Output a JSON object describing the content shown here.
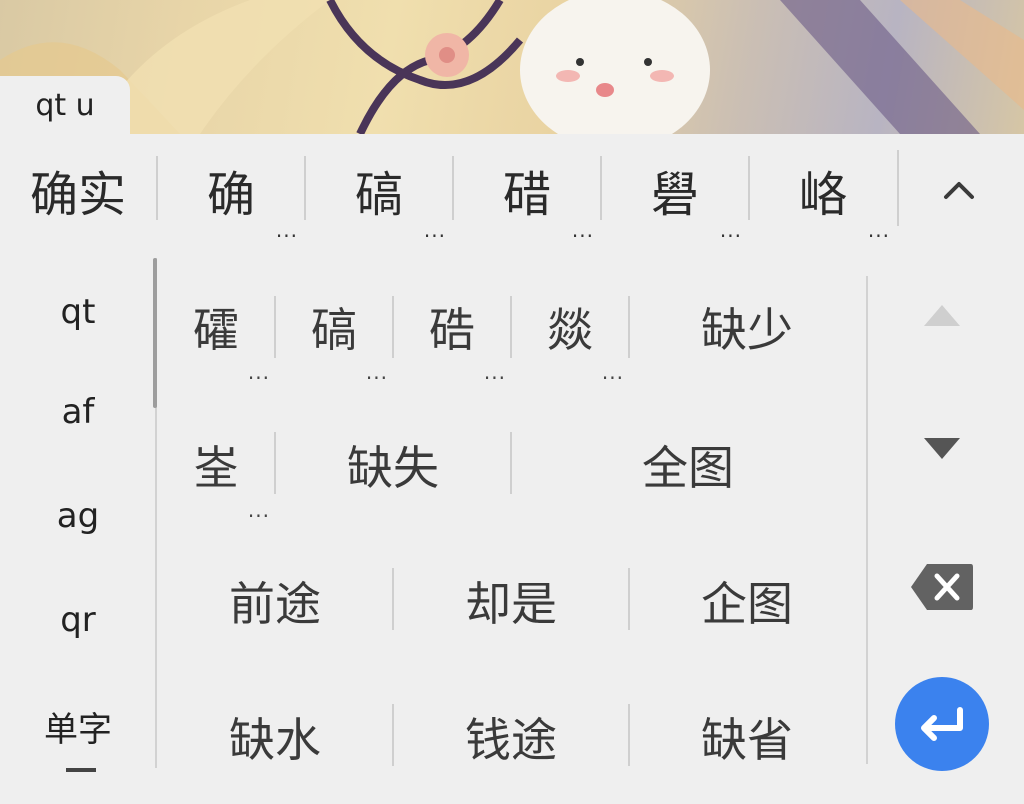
{
  "composing": {
    "text": "qt u"
  },
  "candidates": [
    {
      "text": "确实",
      "has_more": false
    },
    {
      "text": "确",
      "has_more": true,
      "more": "..."
    },
    {
      "text": "碻",
      "has_more": true,
      "more": "..."
    },
    {
      "text": "碏",
      "has_more": true,
      "more": "..."
    },
    {
      "text": "礐",
      "has_more": true,
      "more": "..."
    },
    {
      "text": "峈",
      "has_more": true,
      "more": "..."
    }
  ],
  "expand_icon": "chevron-up-icon",
  "pinyin_options": [
    "qt",
    "af",
    "ag",
    "qr",
    "单字"
  ],
  "grid": {
    "row1": [
      {
        "text": "礭",
        "more": "..."
      },
      {
        "text": "碻",
        "more": "..."
      },
      {
        "text": "硞",
        "more": "..."
      },
      {
        "text": "燚",
        "more": "..."
      },
      {
        "text": "缺少"
      }
    ],
    "row2": [
      {
        "text": "峑",
        "more": "..."
      },
      {
        "text": "缺失"
      },
      {
        "text": "全图"
      }
    ],
    "row3": [
      {
        "text": "前途"
      },
      {
        "text": "却是"
      },
      {
        "text": "企图"
      }
    ],
    "row4": [
      {
        "text": "缺水"
      },
      {
        "text": "钱途"
      },
      {
        "text": "缺省"
      }
    ]
  },
  "side_buttons": {
    "page_up_icon": "triangle-up-icon",
    "page_down_icon": "triangle-down-icon",
    "backspace_icon": "backspace-icon",
    "enter_icon": "enter-icon"
  },
  "colors": {
    "accent": "#3b82ee",
    "background": "#efefef"
  }
}
